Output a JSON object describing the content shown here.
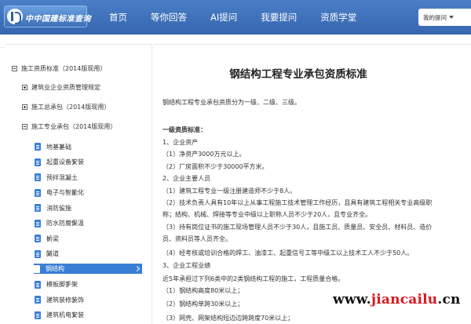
{
  "header": {
    "logo_text": "中中国建标准查询",
    "nav": [
      "首页",
      "等你回答",
      "AI提问",
      "我要提问",
      "资质学堂"
    ],
    "search_label": "我的提问"
  },
  "sidebar": {
    "root": "施工资质标准（2014版现用）",
    "groups": [
      {
        "label": "建筑业企业资质管理规定"
      },
      {
        "label": "施工总承包（2014版现用）"
      },
      {
        "label": "施工专业承包（2014版现用）"
      }
    ],
    "leaves": [
      "地基基础",
      "起重设备安装",
      "预拌混凝土",
      "电子与智能化",
      "消防设施",
      "防水防腐保温",
      "桥梁",
      "隧道",
      "钢结构",
      "模板脚手架",
      "建筑装修装饰",
      "建筑机电安装",
      "建筑幕墙"
    ],
    "active_index": 8
  },
  "content": {
    "title": "钢结构工程专业承包资质标准",
    "lines": [
      "钢结构工程专业承包资质分为一级、二级、三级。",
      "一级资质标准：",
      "1、企业资产",
      "（1）净资产3000万元以上。",
      "（2）厂房面积不少于30000平方米。",
      "2、企业主要人员",
      "（1）建筑工程专业一级注册建造师不少于8人。",
      "（2）技术负责人具有10年以上从事工程施工技术管理工作经历，且具有建筑工程相关专业高级职",
      "称；结构、机械、焊接等专业中级以上职称人员不少于20人，且专业齐全。",
      "（3）持有岗位证书的施工现场管理人员不少于30人，且施工员、质量员、安全员、材料员、造价",
      "员、资料员等人员齐全。",
      "（4）经考核或培训合格的焊工、油漆工、起重信号工等中级工以上技术工人不少于50人。",
      "3、企业工程业绩",
      "近5年承担过下列6类中的2类钢结构工程的施工，工程质量合格。",
      "（1）钢结构高度80米以上；",
      "（2）钢结构单跨30米以上；",
      "（3）网壳、网架结构短边边跨跨度70米以上；"
    ]
  },
  "watermark": {
    "prefix": "www.",
    "brand": "jiancailu",
    "suffix": ".cn"
  }
}
